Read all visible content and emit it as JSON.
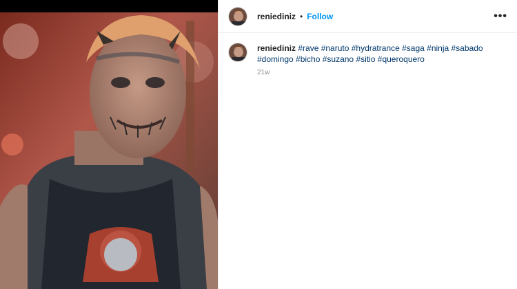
{
  "post": {
    "username": "reniediniz",
    "separator": "•",
    "follow_label": "Follow",
    "more_label": "•••"
  },
  "caption": {
    "username": "reniediniz",
    "hashtags": "#rave #naruto #hydratrance #saga #ninja #sabado #domingo #bicho #suzano #sitio #queroquero",
    "age": "21w"
  },
  "icons": {
    "more": "more-options-icon"
  },
  "colors": {
    "follow_blue": "#0095f6",
    "hashtag_navy": "#00376b",
    "timestamp_gray": "#8e8e8e",
    "border": "#efefef"
  }
}
